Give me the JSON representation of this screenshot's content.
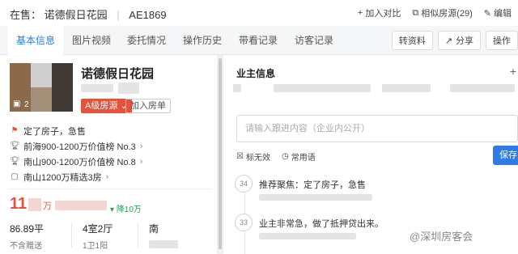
{
  "header": {
    "status": "在售：",
    "name": "诺德假日花园",
    "code": "AE1869",
    "actions": [
      {
        "icon": "plus-icon",
        "label": "加入对比"
      },
      {
        "icon": "similar-icon",
        "label": "相似房源(29)"
      },
      {
        "icon": "edit-icon",
        "label": "编辑"
      }
    ]
  },
  "tabs": [
    "基本信息",
    "图片视频",
    "委托情况",
    "操作历史",
    "带看记录",
    "访客记录"
  ],
  "toolbar": {
    "transfer_label": "转资料",
    "share_label": "分享",
    "more_label": "操作"
  },
  "house": {
    "title": "诺德假日花园",
    "photo_count": "2",
    "level": "A级房源",
    "join_label": "加入房单",
    "hot_tag": "定了房子，急售",
    "ranks": [
      "前海900-1200万价值榜 No.3",
      "南山900-1200万价值榜 No.8",
      "南山1200万精选3房"
    ],
    "price_major": "11",
    "price_unit": "万",
    "price_drop": "降10万",
    "stats": [
      {
        "value": "86.89平",
        "label": "不含赠送"
      },
      {
        "value": "4室2厅",
        "label": "1卫1阳"
      },
      {
        "value": "南",
        "label": ""
      }
    ]
  },
  "owner": {
    "title": "业主信息",
    "input_placeholder": "请输入跟进内容（企业内公开）",
    "mark_invalid": "标无效",
    "common_phrases": "常用语",
    "save_label": "保存",
    "notes": [
      {
        "index": "34",
        "text": "推荐聚焦：定了房子，急售"
      },
      {
        "index": "33",
        "text": "业主非常急，做了抵押贷出来。"
      }
    ]
  },
  "watermark": "@深圳房客会"
}
